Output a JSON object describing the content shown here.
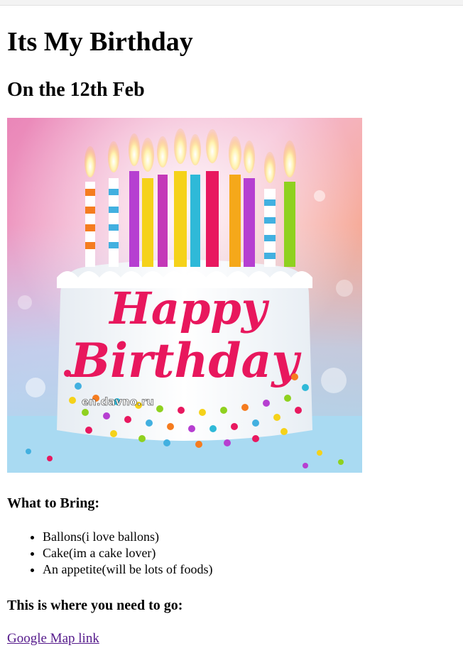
{
  "page": {
    "title": "Its My Birthday",
    "subtitle": "On the 12th Feb",
    "image": {
      "greeting_line1": "Happy",
      "greeting_line2": "Birthday",
      "watermark": "en.davno.ru"
    },
    "bring": {
      "heading": "What to Bring:",
      "items": [
        "Ballons(i love ballons)",
        "Cake(im a cake lover)",
        "An appetite(will be lots of foods)"
      ]
    },
    "directions": {
      "heading": "This is where you need to go:",
      "link_text": "Google Map link"
    }
  },
  "colors": {
    "link_visited": "#551a8b",
    "greeting_pink": "#e8175d"
  }
}
